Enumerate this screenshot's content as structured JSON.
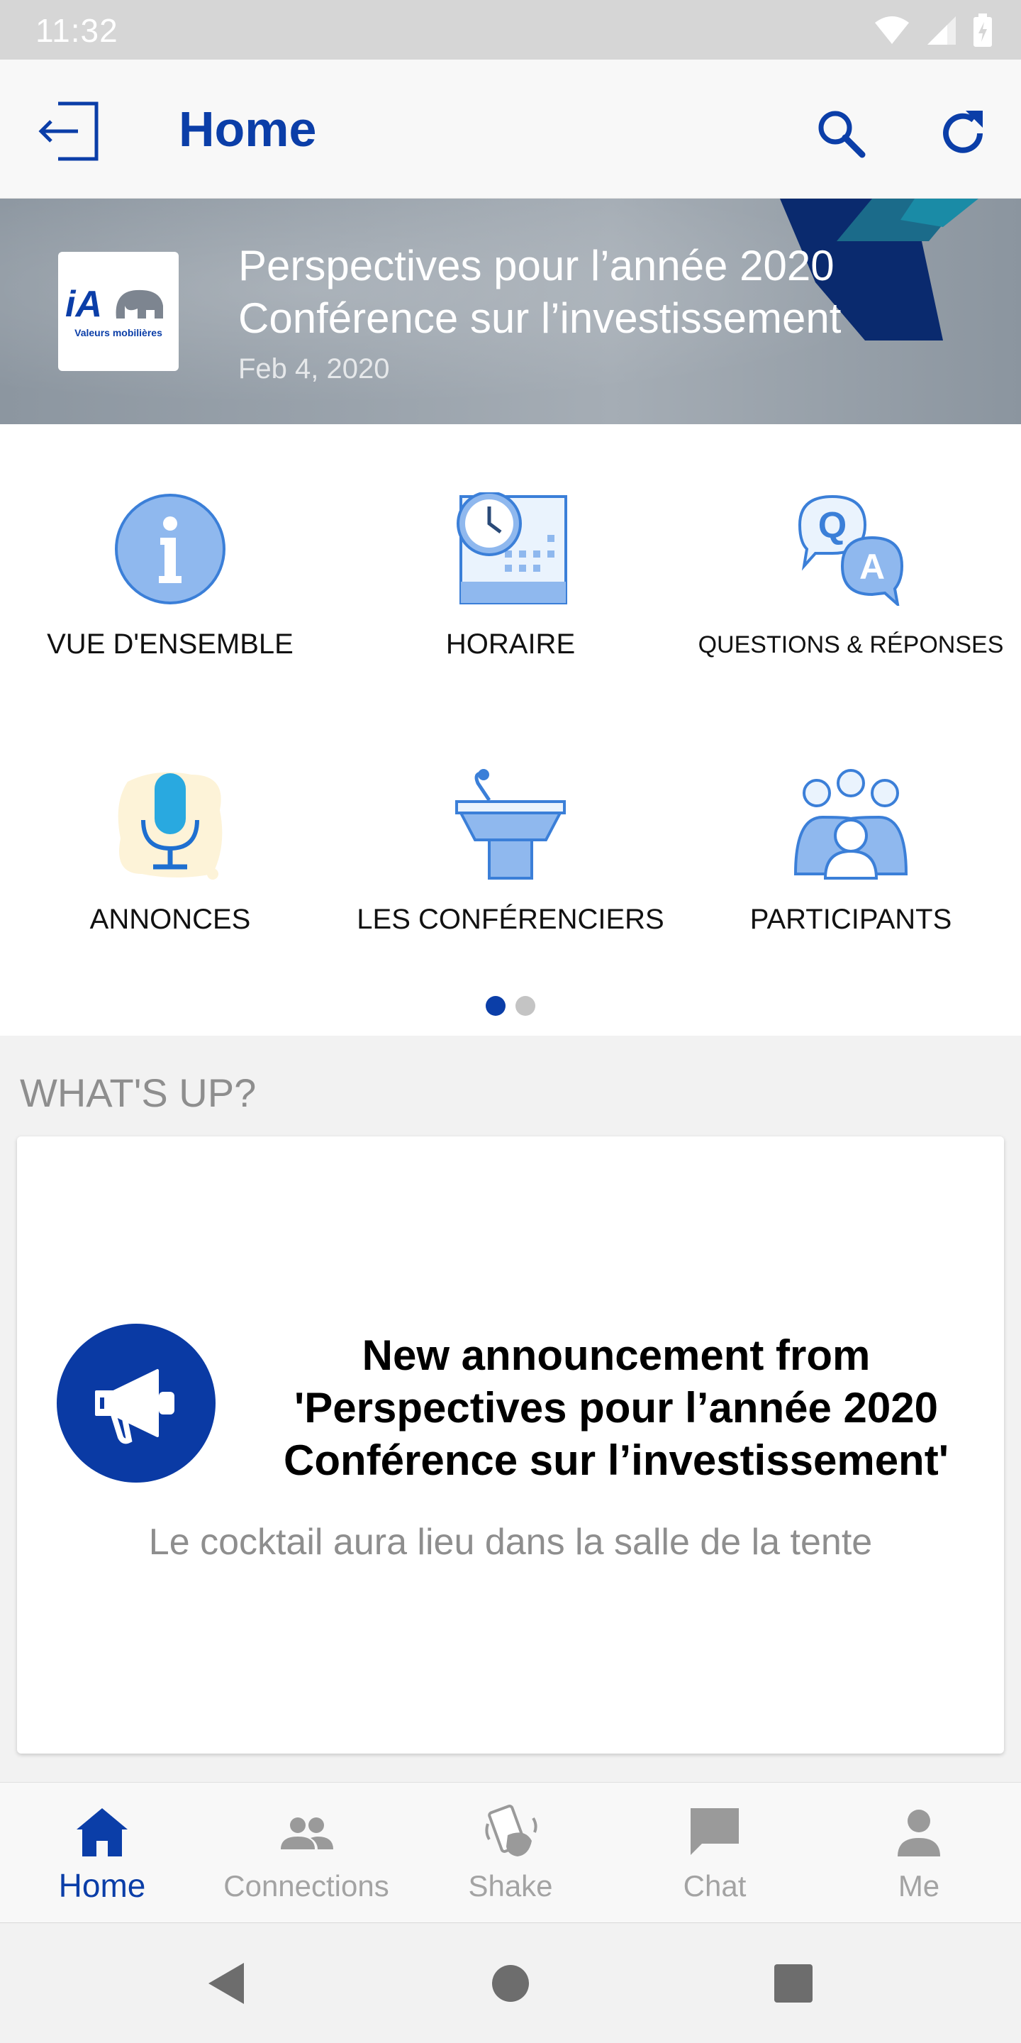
{
  "status_bar": {
    "time": "11:32"
  },
  "app_bar": {
    "title": "Home"
  },
  "banner": {
    "title_line1": "Perspectives pour l’année 2020",
    "title_line2": "Conférence sur l’investissement",
    "date": "Feb 4, 2020",
    "logo_text": "iA",
    "logo_subtext": "Valeurs mobilières"
  },
  "tiles": [
    {
      "label": "VUE D'ENSEMBLE",
      "icon": "info-icon"
    },
    {
      "label": "HORAIRE",
      "icon": "schedule-icon"
    },
    {
      "label": "QUESTIONS & RÉPONSES",
      "icon": "qa-icon"
    },
    {
      "label": "ANNONCES",
      "icon": "microphone-icon"
    },
    {
      "label": "LES CONFÉRENCIERS",
      "icon": "podium-icon"
    },
    {
      "label": "PARTICIPANTS",
      "icon": "people-icon"
    }
  ],
  "pager": {
    "current": 1,
    "total": 2
  },
  "whatsup": {
    "title": "WHAT'S UP?",
    "card": {
      "headline_line1": "New announcement from",
      "headline_line2": "'Perspectives pour l’année 2020",
      "headline_line3": "Conférence sur l’investissement'",
      "body": "Le cocktail aura lieu dans la salle de la tente"
    }
  },
  "bottom_nav": [
    {
      "label": "Home",
      "icon": "home-icon",
      "active": true
    },
    {
      "label": "Connections",
      "icon": "connections-icon",
      "active": false
    },
    {
      "label": "Shake",
      "icon": "shake-icon",
      "active": false
    },
    {
      "label": "Chat",
      "icon": "chat-icon",
      "active": false
    },
    {
      "label": "Me",
      "icon": "person-icon",
      "active": false
    }
  ],
  "colors": {
    "primary": "#0b3ea8",
    "icon_light": "#8fb8ee",
    "muted": "#a3a3a3"
  }
}
